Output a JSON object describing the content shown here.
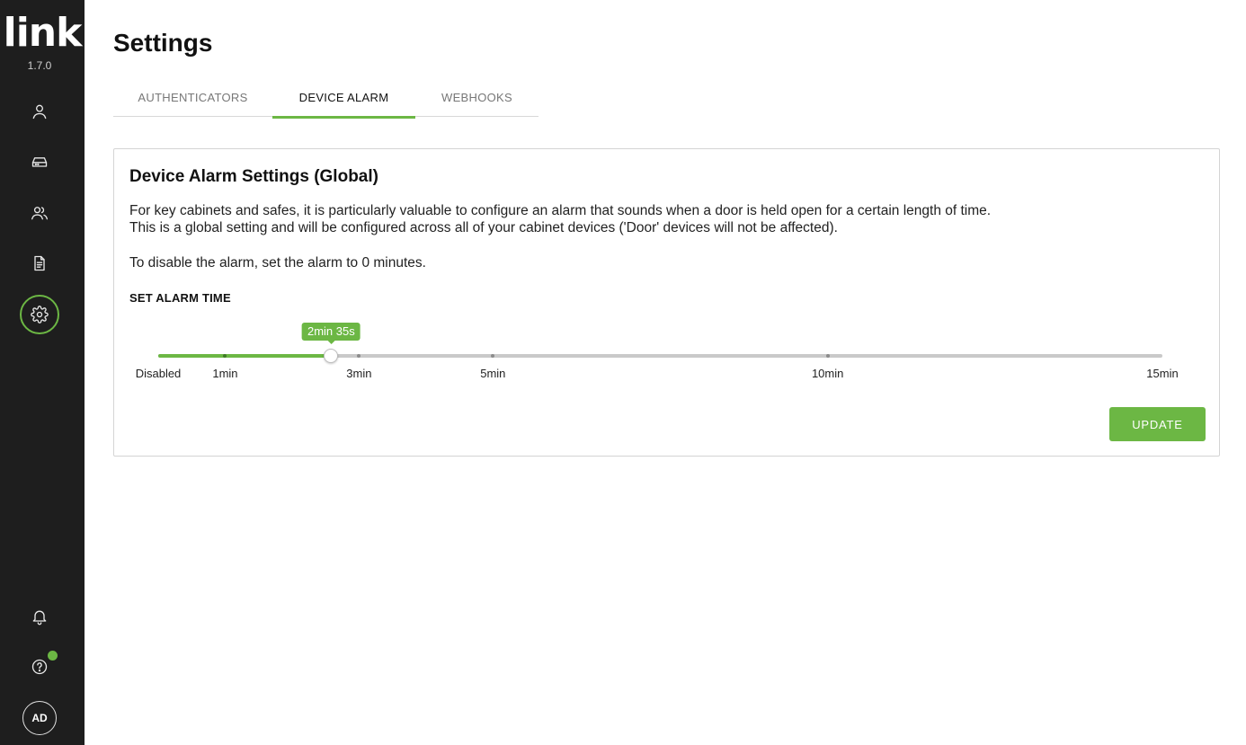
{
  "app": {
    "logo_text": "link",
    "version": "1.7.0",
    "avatar_initials": "AD"
  },
  "sidebar": {
    "items": [
      {
        "name": "user-icon"
      },
      {
        "name": "device-icon"
      },
      {
        "name": "users-group-icon"
      },
      {
        "name": "document-icon"
      },
      {
        "name": "gear-icon",
        "active": true
      }
    ],
    "bottom": [
      {
        "name": "bell-icon"
      },
      {
        "name": "help-icon",
        "badge": true
      }
    ]
  },
  "page": {
    "title": "Settings"
  },
  "tabs": [
    {
      "label": "AUTHENTICATORS",
      "active": false
    },
    {
      "label": "DEVICE ALARM",
      "active": true
    },
    {
      "label": "WEBHOOKS",
      "active": false
    }
  ],
  "card": {
    "title": "Device Alarm Settings (Global)",
    "desc_line1": "For key cabinets and safes, it is particularly valuable to configure an alarm that sounds when a door is held open for a certain length of time.",
    "desc_line2": "This is a global setting and will be configured across all of your cabinet devices ('Door' devices will not be affected).",
    "desc_line3": "To disable the alarm, set the alarm to 0 minutes.",
    "section_label": "SET ALARM TIME",
    "slider": {
      "value_label": "2min 35s",
      "value_seconds": 155,
      "max_seconds": 900,
      "marks": [
        {
          "label": "Disabled",
          "seconds": 0
        },
        {
          "label": "1min",
          "seconds": 60
        },
        {
          "label": "3min",
          "seconds": 180
        },
        {
          "label": "5min",
          "seconds": 300
        },
        {
          "label": "10min",
          "seconds": 600
        },
        {
          "label": "15min",
          "seconds": 900
        }
      ]
    },
    "update_label": "UPDATE"
  },
  "colors": {
    "accent": "#6cb744",
    "sidebar_bg": "#1e1e1e"
  }
}
